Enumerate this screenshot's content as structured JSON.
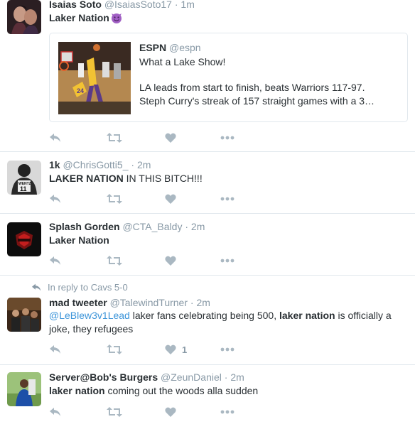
{
  "colors": {
    "icon_gray": "#aab8c2",
    "link_blue": "#3b94d9",
    "name": "#292f33",
    "meta": "#8899a6"
  },
  "tweets": [
    {
      "fullname": "Isaias Soto",
      "username": "@IsaiasSoto17",
      "time": "1m",
      "text_bold": "Laker Nation",
      "emoji": "smiling-devil",
      "quoted": {
        "fullname": "ESPN",
        "username": "@espn",
        "line1": "What a Lake Show!",
        "line2": "LA leads from start to finish, beats Warriors 117-97.",
        "line3": "Steph Curry's streak of 157 straight games with a 3…"
      }
    },
    {
      "fullname": "1k",
      "username": "@ChrisGotti5_",
      "time": "2m",
      "text_bold": "LAKER NATION",
      "text_rest": " IN THIS BITCH!!!"
    },
    {
      "fullname": "Splash Gorden",
      "username": "@CTA_Baldy",
      "time": "2m",
      "text_bold": "Laker Nation"
    },
    {
      "reply_context": "In reply to Cavs 5-0",
      "fullname": "mad tweeter",
      "username": "@TalewindTurner",
      "time": "2m",
      "mention": "@LeBlew3v1Lead",
      "text_part1": " laker fans celebrating being 500, ",
      "text_bold": "laker nation",
      "text_part2": " is officially a joke, they refugees",
      "like_count": "1"
    },
    {
      "fullname": "Server@Bob's Burgers",
      "username": "@ZeunDaniel",
      "time": "2m",
      "text_bold": "laker nation",
      "text_rest": " coming out the woods alla sudden"
    }
  ],
  "separator": "·"
}
